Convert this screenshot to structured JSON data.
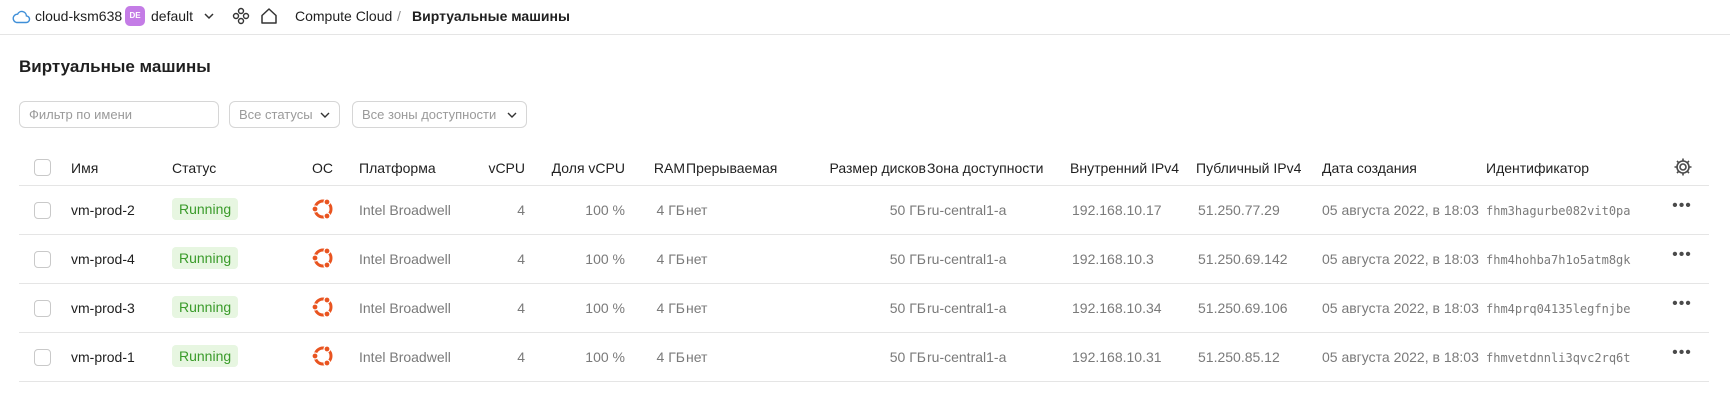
{
  "header": {
    "cloud_name": "cloud-ksm638",
    "folder_badge": "DE",
    "folder_name": "default",
    "breadcrumb_service": "Compute Cloud",
    "breadcrumb_separator": "/",
    "breadcrumb_current": "Виртуальные машины"
  },
  "page": {
    "title": "Виртуальные машины"
  },
  "filters": {
    "name_placeholder": "Фильтр по имени",
    "status_label": "Все статусы",
    "zone_label": "Все зоны доступности"
  },
  "table": {
    "columns": {
      "name": "Имя",
      "status": "Статус",
      "os": "ОС",
      "platform": "Платформа",
      "vcpu": "vCPU",
      "vcpu_share": "Доля vCPU",
      "ram": "RAM",
      "preemptible": "Прерываемая",
      "disk_size": "Размер дисков",
      "zone": "Зона доступности",
      "internal_ip": "Внутренний IPv4",
      "public_ip": "Публичный IPv4",
      "created": "Дата создания",
      "id": "Идентификатор"
    },
    "rows": [
      {
        "name": "vm-prod-2",
        "status": "Running",
        "os_icon": "ubuntu-icon",
        "platform": "Intel Broadwell",
        "vcpu": "4",
        "vcpu_share": "100 %",
        "ram": "4 ГБ",
        "preemptible": "нет",
        "disk_size": "50 ГБ",
        "zone": "ru-central1-a",
        "internal_ip": "192.168.10.17",
        "public_ip": "51.250.77.29",
        "created": "05 августа 2022, в 18:03",
        "id": "fhm3hagurbe082vit0pa"
      },
      {
        "name": "vm-prod-4",
        "status": "Running",
        "os_icon": "ubuntu-icon",
        "platform": "Intel Broadwell",
        "vcpu": "4",
        "vcpu_share": "100 %",
        "ram": "4 ГБ",
        "preemptible": "нет",
        "disk_size": "50 ГБ",
        "zone": "ru-central1-a",
        "internal_ip": "192.168.10.3",
        "public_ip": "51.250.69.142",
        "created": "05 августа 2022, в 18:03",
        "id": "fhm4hohba7h1o5atm8gk"
      },
      {
        "name": "vm-prod-3",
        "status": "Running",
        "os_icon": "ubuntu-icon",
        "platform": "Intel Broadwell",
        "vcpu": "4",
        "vcpu_share": "100 %",
        "ram": "4 ГБ",
        "preemptible": "нет",
        "disk_size": "50 ГБ",
        "zone": "ru-central1-a",
        "internal_ip": "192.168.10.34",
        "public_ip": "51.250.69.106",
        "created": "05 августа 2022, в 18:03",
        "id": "fhm4prq04135legfnjbe"
      },
      {
        "name": "vm-prod-1",
        "status": "Running",
        "os_icon": "ubuntu-icon",
        "platform": "Intel Broadwell",
        "vcpu": "4",
        "vcpu_share": "100 %",
        "ram": "4 ГБ",
        "preemptible": "нет",
        "disk_size": "50 ГБ",
        "zone": "ru-central1-a",
        "internal_ip": "192.168.10.31",
        "public_ip": "51.250.85.12",
        "created": "05 августа 2022, в 18:03",
        "id": "fhmvetdnnli3qvc2rq6t"
      }
    ]
  },
  "colors": {
    "status_running_bg": "#e7f6e1",
    "status_running_text": "#3a9b2a",
    "ubuntu_orange": "#e95420",
    "folder_badge_bg": "#c47ce6"
  }
}
